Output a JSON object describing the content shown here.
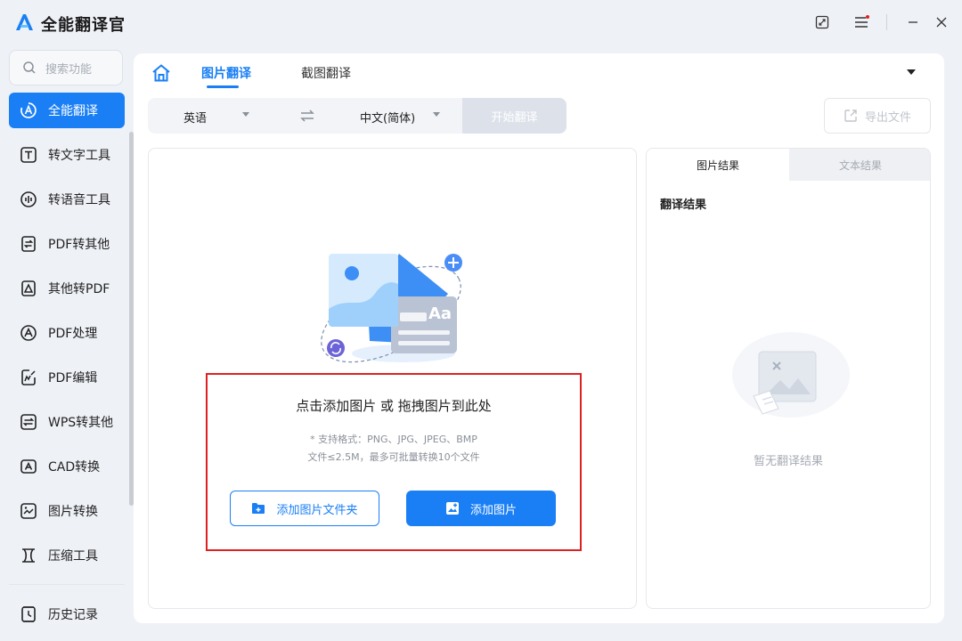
{
  "app": {
    "title": "全能翻译官"
  },
  "search": {
    "placeholder": "搜索功能"
  },
  "sidebar": {
    "items": [
      {
        "label": "全能翻译",
        "icon": "translate-icon",
        "active": true
      },
      {
        "label": "转文字工具",
        "icon": "text-icon"
      },
      {
        "label": "转语音工具",
        "icon": "voice-icon"
      },
      {
        "label": "PDF转其他",
        "icon": "pdf-convert-icon"
      },
      {
        "label": "其他转PDF",
        "icon": "to-pdf-icon"
      },
      {
        "label": "PDF处理",
        "icon": "pdf-process-icon"
      },
      {
        "label": "PDF编辑",
        "icon": "pdf-edit-icon"
      },
      {
        "label": "WPS转其他",
        "icon": "wps-icon"
      },
      {
        "label": "CAD转换",
        "icon": "cad-icon"
      },
      {
        "label": "图片转换",
        "icon": "image-icon"
      },
      {
        "label": "压缩工具",
        "icon": "compress-icon"
      }
    ],
    "history": {
      "label": "历史记录",
      "icon": "history-icon"
    }
  },
  "tabs": {
    "image_translate": "图片翻译",
    "screenshot_translate": "截图翻译"
  },
  "lang": {
    "source": "英语",
    "target": "中文(简体)",
    "start_label": "开始翻译"
  },
  "export": {
    "label": "导出文件"
  },
  "upload": {
    "title": "点击添加图片 或 拖拽图片到此处",
    "hint_formats": "* 支持格式：PNG、JPG、JPEG、BMP",
    "hint_limit": "文件≤2.5M，最多可批量转换10个文件",
    "add_folder_label": "添加图片文件夹",
    "add_image_label": "添加图片"
  },
  "result": {
    "tab_image": "图片结果",
    "tab_text": "文本结果",
    "label": "翻译结果",
    "empty": "暂无翻译结果"
  },
  "colors": {
    "accent": "#1a7ff5",
    "highlight_border": "#e02020"
  }
}
